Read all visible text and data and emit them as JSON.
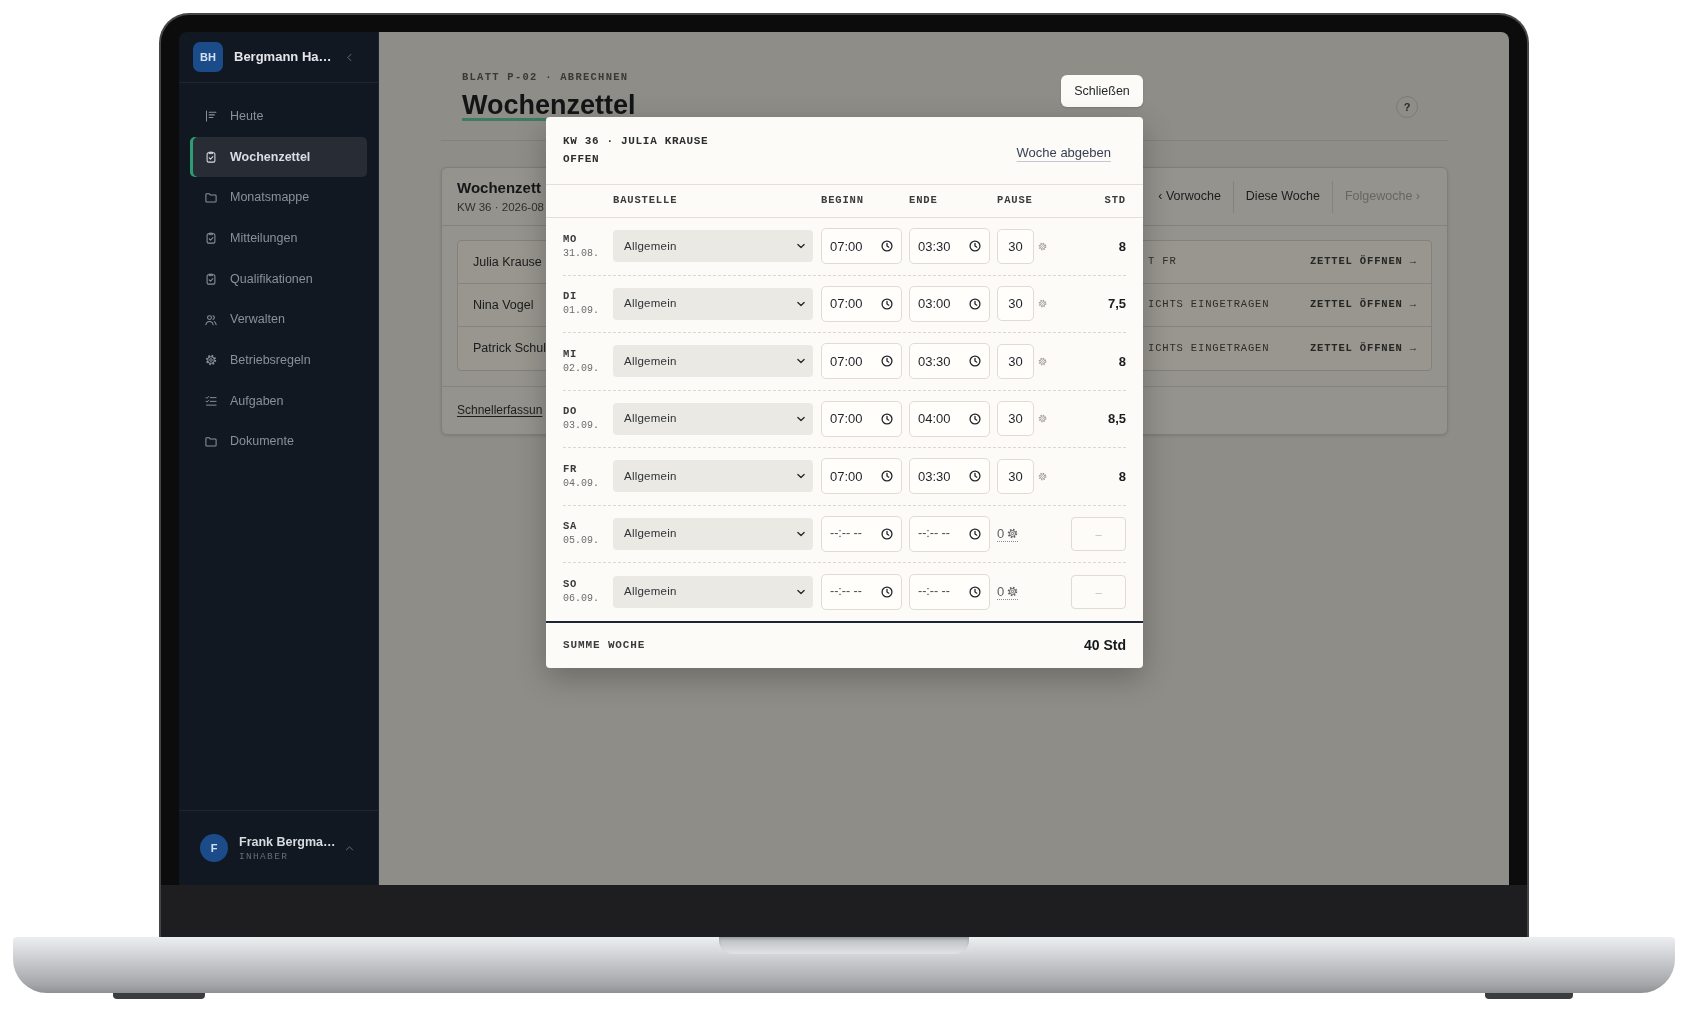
{
  "sidebar": {
    "workspace": {
      "initials": "BH",
      "name": "Bergmann Ha…"
    },
    "items": [
      {
        "label": "Heute",
        "selected": false
      },
      {
        "label": "Wochenzettel",
        "selected": true
      },
      {
        "label": "Monatsmappe",
        "selected": false
      },
      {
        "label": "Mitteilungen",
        "selected": false
      },
      {
        "label": "Qualifikationen",
        "selected": false
      },
      {
        "label": "Verwalten",
        "selected": false
      },
      {
        "label": "Betriebsregeln",
        "selected": false
      },
      {
        "label": "Aufgaben",
        "selected": false
      },
      {
        "label": "Dokumente",
        "selected": false
      }
    ],
    "user": {
      "initial": "F",
      "name": "Frank Bergma…",
      "role": "INHABER"
    }
  },
  "page": {
    "eyebrow": "BLATT P-02 · ABRECHNEN",
    "title": "Wochenzettel",
    "help": "?"
  },
  "card": {
    "title": "Wochenzett",
    "subtitle": "KW 36 · 2026-08",
    "nav": [
      {
        "label": "‹ Vorwoche",
        "disabled": false
      },
      {
        "label": "Diese Woche",
        "disabled": false
      },
      {
        "label": "Folgewoche ›",
        "disabled": true
      }
    ],
    "rows": [
      {
        "name": "Julia Krause",
        "status": "T FR",
        "action": "ZETTEL ÖFFNEN →"
      },
      {
        "name": "Nina Vogel",
        "status": "ICHTS EINGETRAGEN",
        "action": "ZETTEL ÖFFNEN →"
      },
      {
        "name": "Patrick Schul",
        "status": "ICHTS EINGETRAGEN",
        "action": "ZETTEL ÖFFNEN →"
      }
    ],
    "quick_entry": "Schnellerfassun"
  },
  "modal": {
    "close": "Schließen",
    "heading": "KW 36 · JULIA KRAUSE",
    "status": "OFFEN",
    "submit": "Woche abgeben",
    "columns": [
      "BAUSTELLE",
      "BEGINN",
      "ENDE",
      "PAUSE",
      "STD"
    ],
    "days": [
      {
        "kind": "entered",
        "day": "MO",
        "date": "31.08.",
        "site": "Allgemein",
        "start": "07:00",
        "end": "03:30",
        "pause": "30",
        "hours": "8"
      },
      {
        "kind": "entered",
        "day": "DI",
        "date": "01.09.",
        "site": "Allgemein",
        "start": "07:00",
        "end": "03:00",
        "pause": "30",
        "hours": "7,5"
      },
      {
        "kind": "entered",
        "day": "MI",
        "date": "02.09.",
        "site": "Allgemein",
        "start": "07:00",
        "end": "03:30",
        "pause": "30",
        "hours": "8"
      },
      {
        "kind": "entered",
        "day": "DO",
        "date": "03.09.",
        "site": "Allgemein",
        "start": "07:00",
        "end": "04:00",
        "pause": "30",
        "hours": "8,5"
      },
      {
        "kind": "entered",
        "day": "FR",
        "date": "04.09.",
        "site": "Allgemein",
        "start": "07:00",
        "end": "03:30",
        "pause": "30",
        "hours": "8"
      },
      {
        "kind": "empty",
        "day": "SA",
        "date": "05.09.",
        "site": "Allgemein",
        "start_placeholder": "--:-- --",
        "end_placeholder": "--:-- --",
        "pause": "0",
        "hours_placeholder": "–"
      },
      {
        "kind": "empty",
        "day": "SO",
        "date": "06.09.",
        "site": "Allgemein",
        "start_placeholder": "--:-- --",
        "end_placeholder": "--:-- --",
        "pause": "0",
        "hours_placeholder": "–"
      }
    ],
    "total_label": "SUMME WOCHE",
    "total": "40 Std"
  }
}
